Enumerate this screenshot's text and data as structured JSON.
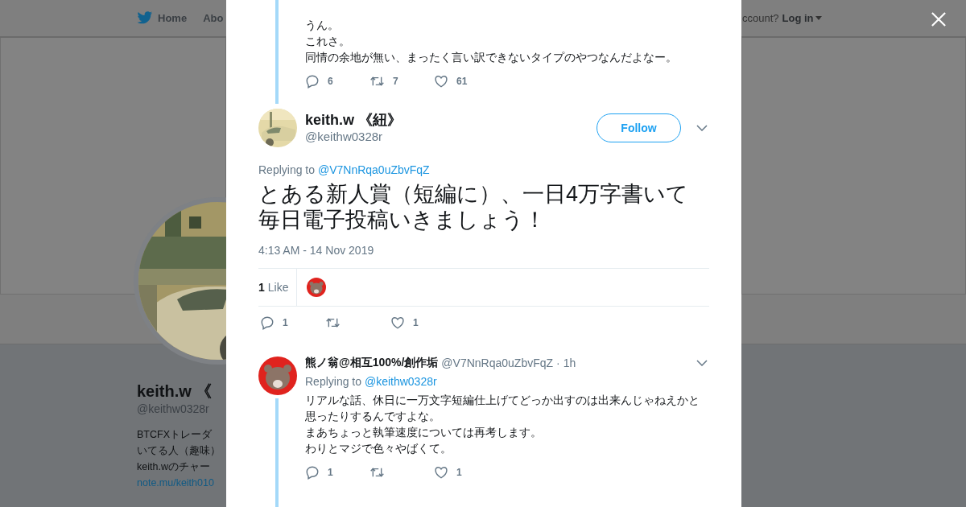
{
  "nav": {
    "items": [
      {
        "label": "Home",
        "kind": "logo"
      },
      {
        "label": "Abo",
        "kind": "plain"
      }
    ],
    "account_prompt": "ccount?",
    "login": "Log in"
  },
  "profile": {
    "name": "keith.w 《",
    "handle": "@keithw0328r",
    "bio_lines": [
      "BTCFXトレーダ",
      "いてる人（趣味）",
      "keith.wのチャー"
    ],
    "link": "note.mu/keith010"
  },
  "parent_tweet": {
    "lines": [
      "うん。",
      "これさ。",
      "同情の余地が無い、まったく言い訳できないタイプのやつなんだよなー。"
    ],
    "actions": {
      "replies": "6",
      "retweets": "7",
      "likes": "61"
    }
  },
  "tweet": {
    "name": "keith.w 《紐》",
    "handle": "@keithw0328r",
    "follow": "Follow",
    "replying_label": "Replying to",
    "replying_to": "@V7NnRqa0uZbvFqZ",
    "lines": [
      "とある新人賞（短編に）、一日4万字書いて",
      "毎日電子投稿いきましょう！"
    ],
    "timestamp": "4:13 AM - 14 Nov 2019",
    "like_count": "1",
    "like_label": "Like",
    "actions": {
      "replies": "1",
      "likes": "1"
    }
  },
  "replies": [
    {
      "name": "熊ノ翁@相互100%/創作垢",
      "handle": "@V7NnRqa0uZbvFqZ",
      "time": "· 1h",
      "replying_label": "Replying to",
      "replying_to": "@keithw0328r",
      "lines": [
        "リアルな話、休日に一万文字短編仕上げてどっか出すのは出来んじゃねえかと",
        "思ったりするんですよな。",
        "まあちょっと執筆速度については再考します。",
        "わりとマジで色々やばくて。"
      ],
      "actions": {
        "replies": "1",
        "likes": "1"
      }
    }
  ]
}
